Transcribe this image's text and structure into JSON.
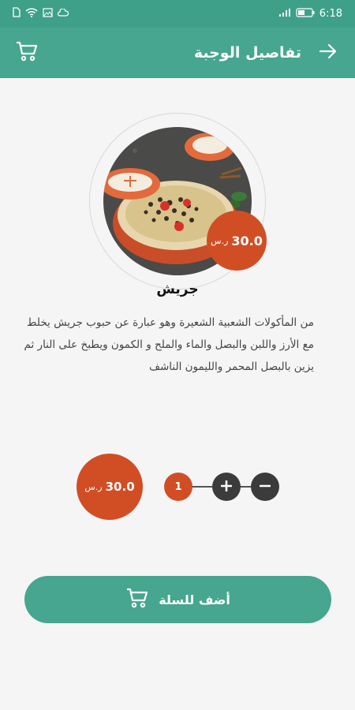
{
  "status": {
    "time": "6:18",
    "battery": "40"
  },
  "header": {
    "title": "تفاصيل الوجبة"
  },
  "meal": {
    "name": "جريش",
    "price": "30.0",
    "currency": "ر.س",
    "description": "من المأكولات الشعبية الشعيرة وهو عبارة عن حبوب جريش يخلط مع الأرز واللبن والبصل والماء والملح و الكمون ويطبخ على النار ثم يزين بالبصل المحمر والليمون الناشف"
  },
  "order": {
    "total": "30.0",
    "currency": "ر.س",
    "quantity": "1"
  },
  "actions": {
    "add_to_cart": "أضف للسلة"
  },
  "colors": {
    "primary": "#46a68f",
    "accent": "#d14e25",
    "dark_button": "#3b3b3b"
  }
}
